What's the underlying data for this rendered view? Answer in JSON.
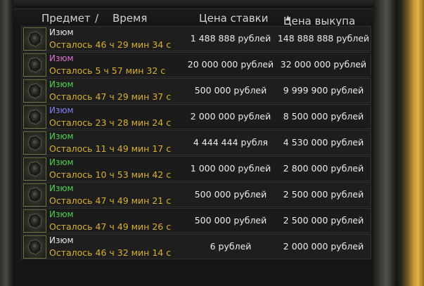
{
  "header": {
    "item_label": "Предмет",
    "separator": "/",
    "time_label": "Время",
    "bid_label": "Цена ставки",
    "buyout_label": "Цена выкупа",
    "sort_indicator": "▲"
  },
  "colors": {
    "white": "#e6e6e6",
    "pink": "#e070d0",
    "blue": "#8080ee",
    "green": "#50d050",
    "time_gold": "#d8b030"
  },
  "rows": [
    {
      "name": "Изюм",
      "color": "#e6e6e6",
      "time": "Осталось 46 ч 29 мин 34 с",
      "bid": "1 488 888 рублей",
      "buyout": "148 888 888 рублей",
      "icon": "artifact-izyum-icon"
    },
    {
      "name": "Изюм",
      "color": "#e070d0",
      "time": "Осталось 5 ч 57 мин 32 с",
      "bid": "20 000 000 рублей",
      "buyout": "32 000 000 рублей",
      "icon": "artifact-izyum-icon"
    },
    {
      "name": "Изюм",
      "color": "#50d050",
      "time": "Осталось 47 ч 29 мин 37 с",
      "bid": "500 000 рублей",
      "buyout": "9 999 900 рублей",
      "icon": "artifact-izyum-icon"
    },
    {
      "name": "Изюм",
      "color": "#8080ee",
      "time": "Осталось 23 ч 28 мин 24 с",
      "bid": "2 000 000 рублей",
      "buyout": "8 500 000 рублей",
      "icon": "artifact-izyum-icon"
    },
    {
      "name": "Изюм",
      "color": "#50d050",
      "time": "Осталось 11 ч 49 мин 17 с",
      "bid": "4 444 444 рубля",
      "buyout": "4 530 000 рублей",
      "icon": "artifact-izyum-icon"
    },
    {
      "name": "Изюм",
      "color": "#50d050",
      "time": "Осталось 10 ч 53 мин 42 с",
      "bid": "1 000 000 рублей",
      "buyout": "2 800 000 рублей",
      "icon": "artifact-izyum-icon"
    },
    {
      "name": "Изюм",
      "color": "#50d050",
      "time": "Осталось 47 ч 49 мин 21 с",
      "bid": "500 000 рублей",
      "buyout": "2 500 000 рублей",
      "icon": "artifact-izyum-icon"
    },
    {
      "name": "Изюм",
      "color": "#50d050",
      "time": "Осталось 47 ч 49 мин 26 с",
      "bid": "500 000 рублей",
      "buyout": "2 500 000 рублей",
      "icon": "artifact-izyum-icon"
    },
    {
      "name": "Изюм",
      "color": "#e6e6e6",
      "time": "Осталось 46 ч 32 мин 14 с",
      "bid": "6 рублей",
      "buyout": "2 000 000 рублей",
      "icon": "artifact-izyum-icon"
    }
  ]
}
